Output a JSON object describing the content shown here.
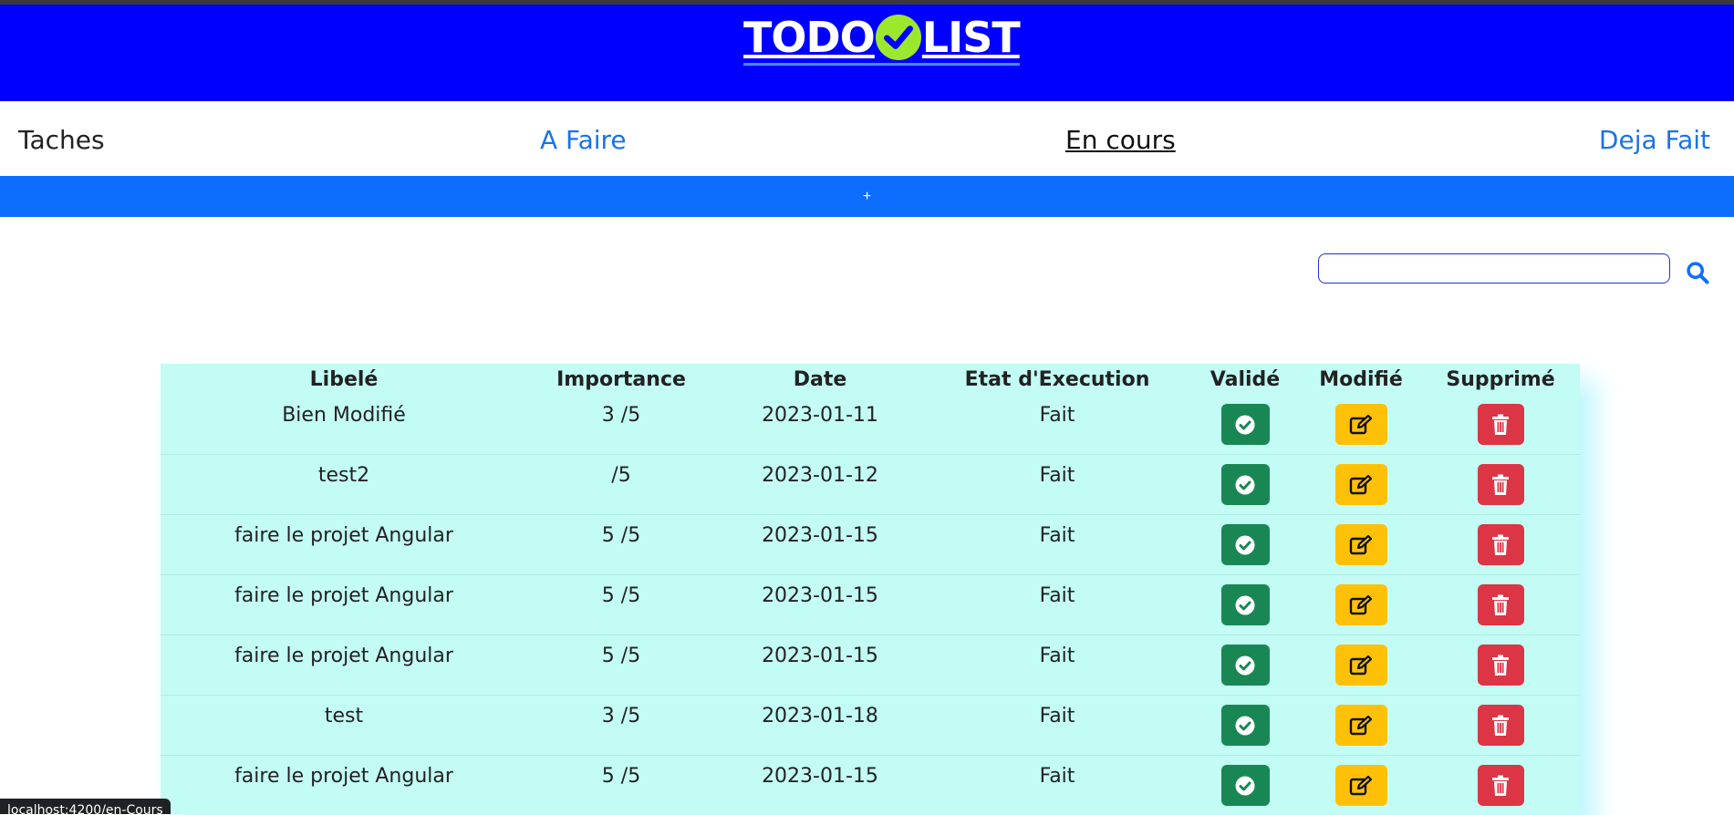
{
  "header": {
    "logo_part1": "TODO",
    "logo_part2": "LIST",
    "logo_icon": "check-circle-icon",
    "logo_icon_color": "#9be82e",
    "background": "#0000ff"
  },
  "nav": {
    "title": "Taches",
    "tabs": [
      {
        "label": "A Faire",
        "active": false
      },
      {
        "label": "En cours",
        "active": true
      },
      {
        "label": "Deja Fait",
        "active": false
      }
    ]
  },
  "add_bar": {
    "label": "+",
    "color": "#0d6efd"
  },
  "search": {
    "value": "",
    "placeholder": "",
    "icon": "search-icon"
  },
  "table": {
    "headers": [
      "Libelé",
      "Importance",
      "Date",
      "Etat d'Execution",
      "Validé",
      "Modifié",
      "Supprimé"
    ],
    "rows": [
      {
        "libelle": "Bien Modifié",
        "importance": "3 /5",
        "date": "2023-01-11",
        "etat": "Fait"
      },
      {
        "libelle": "test2",
        "importance": "/5",
        "date": "2023-01-12",
        "etat": "Fait"
      },
      {
        "libelle": "faire le projet Angular",
        "importance": "5 /5",
        "date": "2023-01-15",
        "etat": "Fait"
      },
      {
        "libelle": "faire le projet Angular",
        "importance": "5 /5",
        "date": "2023-01-15",
        "etat": "Fait"
      },
      {
        "libelle": "faire le projet Angular",
        "importance": "5 /5",
        "date": "2023-01-15",
        "etat": "Fait"
      },
      {
        "libelle": "test",
        "importance": "3 /5",
        "date": "2023-01-18",
        "etat": "Fait"
      },
      {
        "libelle": "faire le projet Angular",
        "importance": "5 /5",
        "date": "2023-01-15",
        "etat": "Fait"
      }
    ],
    "action_icons": {
      "valid": "check-circle-icon",
      "edit": "edit-icon",
      "delete": "trash-icon"
    },
    "colors": {
      "background": "#c2fcf4",
      "valid": "#198754",
      "edit": "#ffc107",
      "delete": "#dc3545"
    }
  },
  "status_bar": {
    "url": "localhost:4200/en-Cours"
  }
}
